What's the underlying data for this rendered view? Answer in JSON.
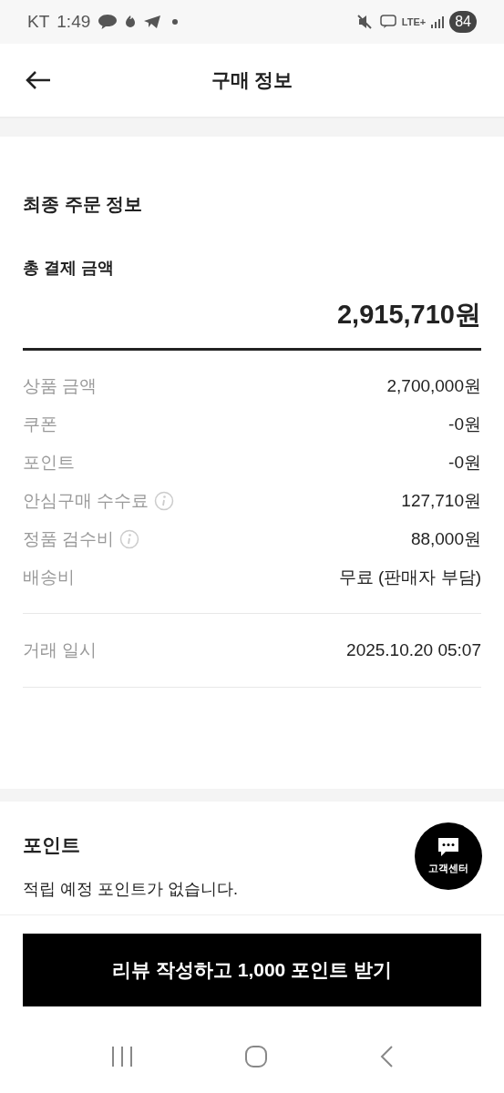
{
  "status_bar": {
    "carrier": "KT",
    "time": "1:49",
    "network": "LTE+",
    "battery": "84"
  },
  "header": {
    "title": "구매 정보"
  },
  "order_summary": {
    "title": "최종 주문 정보",
    "total_label": "총 결제 금액",
    "total_value": "2,915,710원",
    "rows": [
      {
        "label": "상품 금액",
        "value": "2,700,000원",
        "info": false
      },
      {
        "label": "쿠폰",
        "value": "-0원",
        "info": false
      },
      {
        "label": "포인트",
        "value": "-0원",
        "info": false
      },
      {
        "label": "안심구매 수수료",
        "value": "127,710원",
        "info": true
      },
      {
        "label": "정품 검수비",
        "value": "88,000원",
        "info": true
      },
      {
        "label": "배송비",
        "value": "무료 (판매자 부담)",
        "info": false
      }
    ],
    "date_label": "거래 일시",
    "date_value": "2025.10.20 05:07"
  },
  "points": {
    "title": "포인트",
    "message": "적립 예정 포인트가 없습니다."
  },
  "support_button": {
    "label": "고객센터"
  },
  "cta_button": {
    "label": "리뷰 작성하고 1,000 포인트 받기"
  }
}
